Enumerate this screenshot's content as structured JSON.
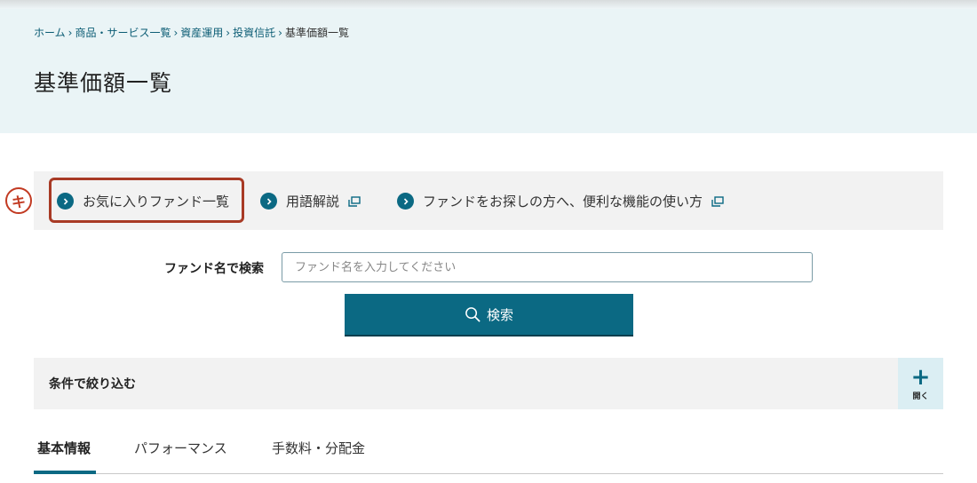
{
  "breadcrumb": {
    "home": "ホーム",
    "products": "商品・サービス一覧",
    "asset_management": "資産運用",
    "investment_trust": "投資信託",
    "current": "基準価額一覧"
  },
  "page": {
    "title": "基準価額一覧"
  },
  "quick_links": {
    "favorites": "お気に入りファンド一覧",
    "glossary": "用語解説",
    "guide": "ファンドをお探しの方へ、便利な機能の使い方"
  },
  "annotation": {
    "marker": "キ"
  },
  "search": {
    "label": "ファンド名で検索",
    "placeholder": "ファンド名を入力してください",
    "value": "",
    "button_label": "検索"
  },
  "filter": {
    "title": "条件で絞り込む",
    "open_label": "開く",
    "open_icon": "plus-icon"
  },
  "tabs": {
    "basic": "基本情報",
    "performance": "パフォーマンス",
    "fees": "手数料・分配金"
  },
  "colors": {
    "accent": "#0b6983",
    "hero_bg": "#eaf4f6",
    "highlight": "#a83a25"
  }
}
